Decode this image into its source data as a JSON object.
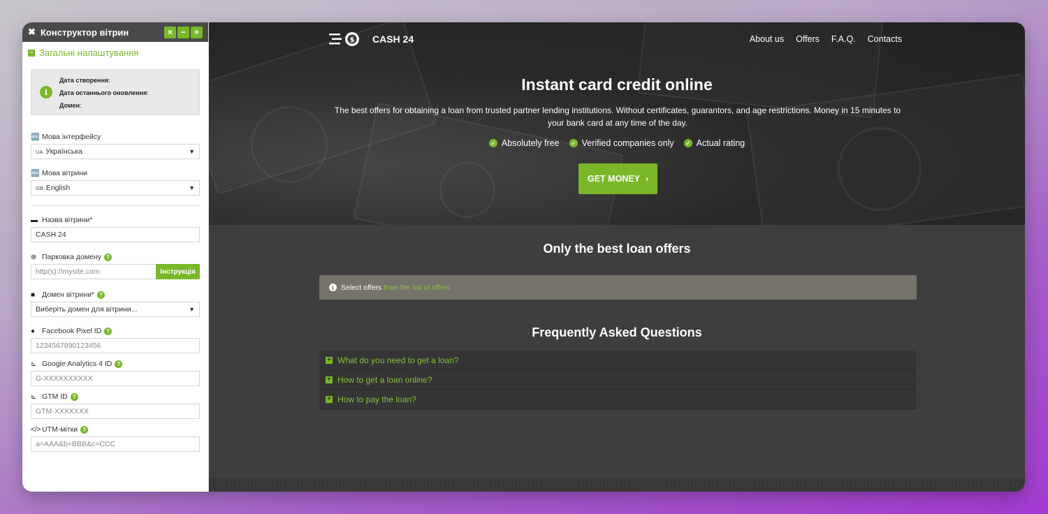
{
  "builder": {
    "title": "Конструктор вітрин",
    "window_buttons": [
      "×",
      "−",
      "+"
    ],
    "section_title": "Загальні налаштування",
    "info": {
      "created_label": "Дата створення",
      "updated_label": "Дата останнього оновлення",
      "domain_label": "Домен"
    },
    "interface_lang": {
      "label": "Мова інтерфейсу",
      "flag": "UA",
      "value": "Українська"
    },
    "storefront_lang": {
      "label": "Мова вітрини",
      "flag": "GB",
      "value": "English"
    },
    "storefront_name": {
      "label": "Назва вітрини*",
      "value": "CASH 24"
    },
    "domain_parking": {
      "label": "Парковка домену",
      "placeholder": "http(s)://mysite.com",
      "button": "Інструкція"
    },
    "storefront_domain": {
      "label": "Домен вітрини*",
      "value": "Виберіть домен для вітрини..."
    },
    "facebook_pixel": {
      "label": "Facebook Pixel ID",
      "placeholder": "1234567890123456"
    },
    "google_analytics": {
      "label": "Google Analytics 4 ID",
      "placeholder": "G-XXXXXXXXXX"
    },
    "gtm": {
      "label": "GTM ID",
      "placeholder": "GTM-XXXXXXX"
    },
    "utm": {
      "label": "UTM-мітки",
      "placeholder": "a=AAA&b=BBB&c=CCC"
    }
  },
  "site": {
    "logo_text": "CASH 24",
    "nav": [
      "About us",
      "Offers",
      "F.A.Q.",
      "Contacts"
    ],
    "hero_title": "Instant card credit online",
    "hero_subtitle": "The best offers for obtaining a loan from trusted partner lending institutions. Without certificates, guarantors, and age restrictions. Money in 15 minutes to your bank card at any time of the day.",
    "features": [
      "Absolutely free",
      "Verified companies only",
      "Actual rating"
    ],
    "cta": "GET MONEY",
    "offers_title": "Only the best loan offers",
    "notice_text": "Select offers",
    "notice_link": "from the list of offers",
    "faq_title": "Frequently Asked Questions",
    "faq": [
      "What do you need to get a loan?",
      "How to get a loan online?",
      "How to pay the loan?"
    ]
  },
  "colors": {
    "accent": "#7ab82a",
    "dark_bg": "#3e3e3e",
    "notice_bg": "#76736a"
  }
}
